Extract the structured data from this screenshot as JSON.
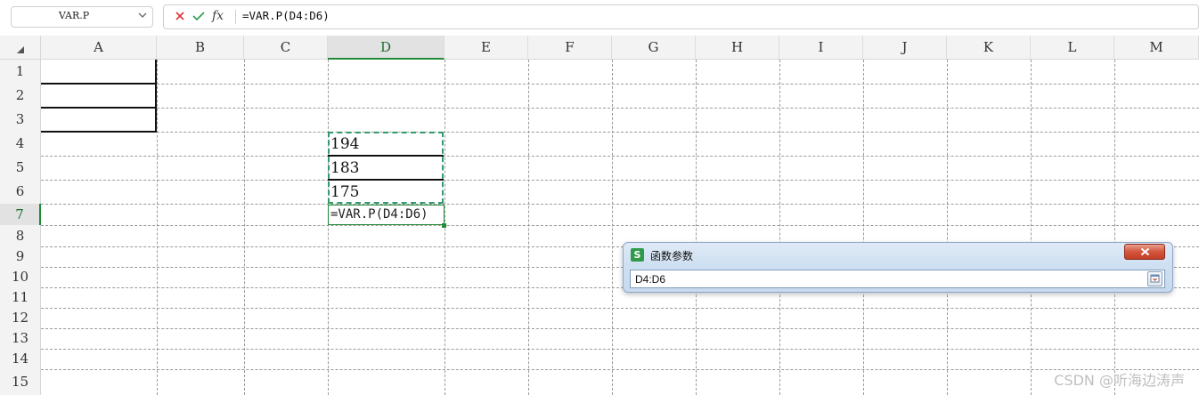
{
  "formula_bar": {
    "name_box": "VAR.P",
    "fx_label": "fx",
    "formula": "=VAR.P(D4:D6)"
  },
  "columns": [
    "A",
    "B",
    "C",
    "D",
    "E",
    "F",
    "G",
    "H",
    "I",
    "J",
    "K",
    "L",
    "M"
  ],
  "rows": [
    "1",
    "2",
    "3",
    "4",
    "5",
    "6",
    "7",
    "8",
    "9",
    "10",
    "11",
    "12",
    "13",
    "14",
    "15"
  ],
  "selected_column": "D",
  "selected_row": "7",
  "cells": {
    "D4": "194",
    "D5": "183",
    "D6": "175",
    "D7": "=VAR.P(D4:D6)"
  },
  "dialog": {
    "title": "函数参数",
    "logo": "S",
    "input_value": "D4:D6"
  },
  "watermark": "CSDN @听海边涛声",
  "colors": {
    "accent_green": "#218a37",
    "marquee": "#2f9a6a",
    "close_red": "#c23f26"
  }
}
